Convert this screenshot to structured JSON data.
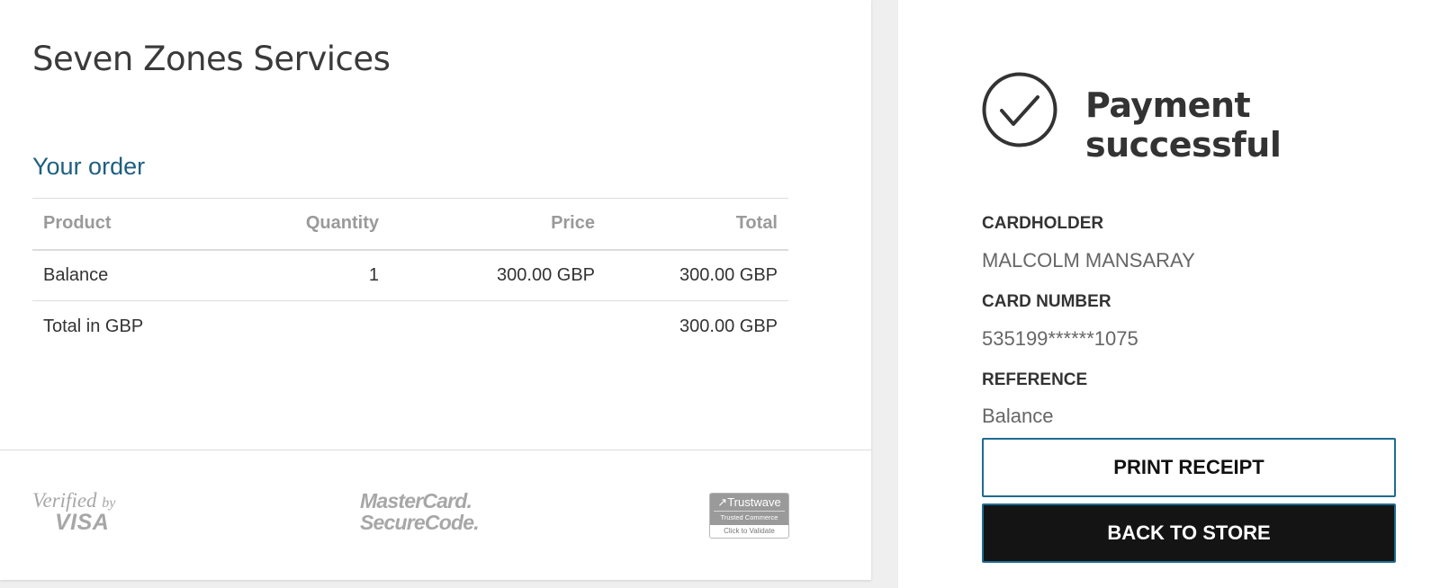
{
  "merchant_name": "Seven Zones Services",
  "order": {
    "title": "Your order",
    "columns": {
      "product": "Product",
      "quantity": "Quantity",
      "price": "Price",
      "total": "Total"
    },
    "items": [
      {
        "product": "Balance",
        "quantity": "1",
        "price": "300.00 GBP",
        "total": "300.00 GBP"
      }
    ],
    "total_label": "Total in GBP",
    "total_value": "300.00 GBP"
  },
  "security_logos": {
    "visa_line1": "Verified",
    "visa_by": "by",
    "visa_line2": "VISA",
    "mastercard_line1": "MasterCard.",
    "mastercard_line2": "SecureCode.",
    "trustwave_brand": "Trustwave",
    "trustwave_sub": "Trusted Commerce",
    "trustwave_validate": "Click to Validate"
  },
  "payment": {
    "status_title": "Payment successful",
    "status_icon": "check-circle-icon",
    "cardholder_label": "CARDHOLDER",
    "cardholder_value": "MALCOLM MANSARAY",
    "card_number_label": "CARD NUMBER",
    "card_number_value": "535199******1075",
    "reference_label": "REFERENCE",
    "reference_value": "Balance"
  },
  "buttons": {
    "print_receipt": "PRINT RECEIPT",
    "back_to_store": "BACK TO STORE"
  },
  "colors": {
    "accent": "#1e5f80",
    "button_border": "#1e6b8f",
    "button_dark": "#141414"
  }
}
